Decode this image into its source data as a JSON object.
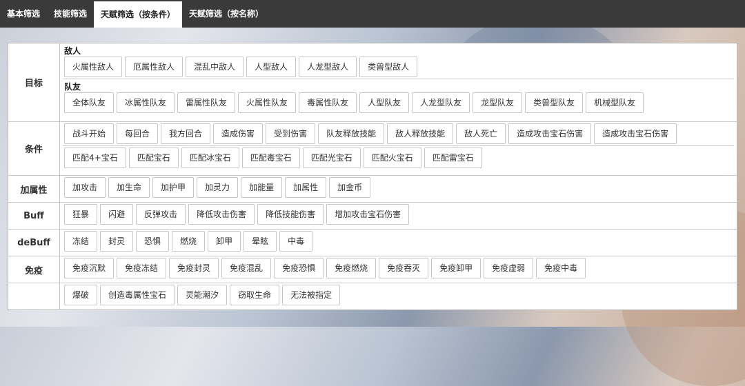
{
  "tabs": [
    {
      "label": "基本筛选"
    },
    {
      "label": "技能筛选"
    },
    {
      "label": "天赋筛选（按条件）"
    },
    {
      "label": "天赋筛选（按名称）"
    }
  ],
  "active_tab": 2,
  "rows": {
    "target": {
      "label": "目标",
      "enemy": {
        "title": "敌人",
        "items": [
          "火属性敌人",
          "厄属性敌人",
          "混乱中敌人",
          "人型敌人",
          "人龙型敌人",
          "类兽型敌人"
        ]
      },
      "ally": {
        "title": "队友",
        "items": [
          "全体队友",
          "冰属性队友",
          "雷属性队友",
          "火属性队友",
          "毒属性队友",
          "人型队友",
          "人龙型队友",
          "龙型队友",
          "类兽型队友",
          "机械型队友"
        ]
      }
    },
    "condition": {
      "label": "条件",
      "line1": [
        "战斗开始",
        "每回合",
        "我方回合",
        "造成伤害",
        "受到伤害",
        "队友释放技能",
        "敌人释放技能",
        "敌人死亡",
        "造成攻击宝石伤害",
        "造成攻击宝石伤害"
      ],
      "line2": [
        "匹配4+宝石",
        "匹配宝石",
        "匹配冰宝石",
        "匹配毒宝石",
        "匹配光宝石",
        "匹配火宝石",
        "匹配雷宝石"
      ]
    },
    "attr": {
      "label": "加属性",
      "items": [
        "加攻击",
        "加生命",
        "加护甲",
        "加灵力",
        "加能量",
        "加属性",
        "加金币"
      ]
    },
    "buff": {
      "label": "Buff",
      "items": [
        "狂暴",
        "闪避",
        "反弹攻击",
        "降低攻击伤害",
        "降低技能伤害",
        "增加攻击宝石伤害"
      ]
    },
    "debuff": {
      "label": "deBuff",
      "items": [
        "冻结",
        "封灵",
        "恐惧",
        "燃烧",
        "卸甲",
        "晕眩",
        "中毒"
      ]
    },
    "immune": {
      "label": "免疫",
      "items": [
        "免疫沉默",
        "免疫冻结",
        "免疫封灵",
        "免疫混乱",
        "免疫恐惧",
        "免疫燃烧",
        "免疫吞灭",
        "免疫卸甲",
        "免疫虚弱",
        "免疫中毒"
      ]
    },
    "other": {
      "label": "",
      "items": [
        "爆破",
        "创造毒属性宝石",
        "灵能潮汐",
        "窃取生命",
        "无法被指定"
      ]
    }
  }
}
